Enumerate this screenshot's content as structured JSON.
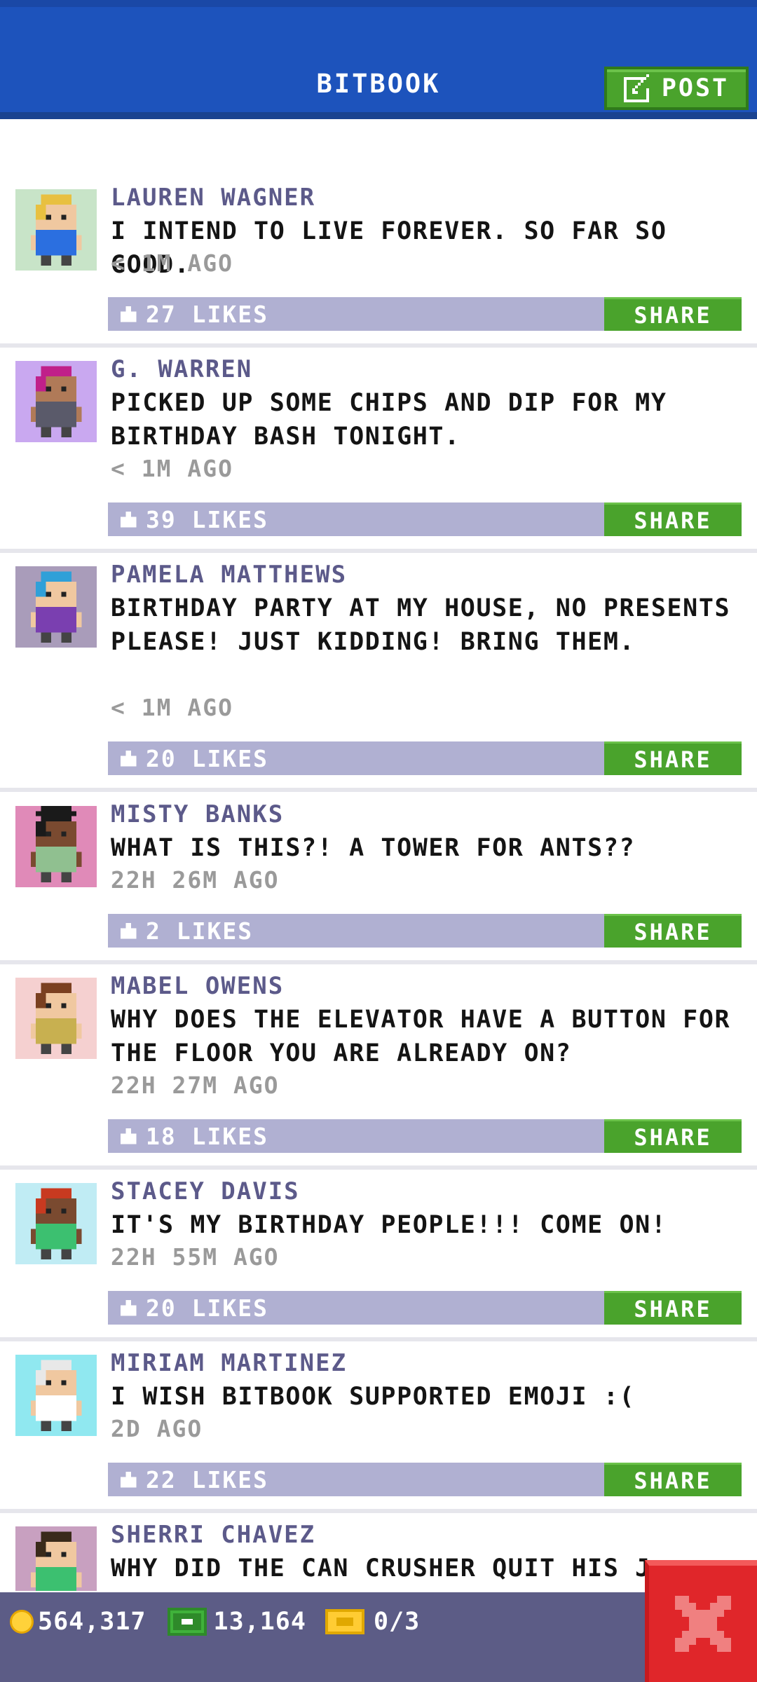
{
  "header": {
    "title": "BITBOOK",
    "post_label": "POST"
  },
  "posts": [
    {
      "name": "LAUREN WAGNER",
      "text": "I INTEND TO LIVE FOREVER. SO FAR SO GOOD.",
      "time": "< 1M AGO",
      "likes": "27 LIKES",
      "share": "SHARE",
      "avatar_bg": "#c8e4c8",
      "avatar_shirt": "#2b6fe0",
      "avatar_hair": "#e8c040"
    },
    {
      "name": "G. WARREN",
      "text": "PICKED UP SOME CHIPS AND DIP FOR MY BIRTHDAY BASH TONIGHT.",
      "time": "< 1M AGO",
      "likes": "39 LIKES",
      "share": "SHARE",
      "avatar_bg": "#c9a8f0",
      "avatar_shirt": "#5a5a6a",
      "avatar_hair": "#c0208a"
    },
    {
      "name": "PAMELA MATTHEWS",
      "text": "BIRTHDAY PARTY AT MY HOUSE, NO PRESENTS PLEASE! JUST KIDDING! BRING THEM.",
      "time": "< 1M AGO",
      "likes": "20 LIKES",
      "share": "SHARE",
      "avatar_bg": "#a99cba",
      "avatar_shirt": "#7a3fb0",
      "avatar_hair": "#30a0d8"
    },
    {
      "name": "MISTY BANKS",
      "text": "WHAT IS THIS?! A TOWER FOR ANTS??",
      "time": "22H 26M AGO",
      "likes": "2 LIKES",
      "share": "SHARE",
      "avatar_bg": "#e08ab8",
      "avatar_shirt": "#90c090",
      "avatar_hair": "#1a1a1a"
    },
    {
      "name": "MABEL OWENS",
      "text": "WHY DOES THE ELEVATOR HAVE A BUTTON FOR THE FLOOR YOU ARE ALREADY ON?",
      "time": "22H 27M AGO",
      "likes": "18 LIKES",
      "share": "SHARE",
      "avatar_bg": "#f5d0d0",
      "avatar_shirt": "#c8b050",
      "avatar_hair": "#7a4020"
    },
    {
      "name": "STACEY DAVIS",
      "text": "IT'S MY BIRTHDAY PEOPLE!!! COME ON!",
      "time": "22H 55M AGO",
      "likes": "20 LIKES",
      "share": "SHARE",
      "avatar_bg": "#c0ecf4",
      "avatar_shirt": "#3cc070",
      "avatar_hair": "#c83a20"
    },
    {
      "name": "MIRIAM MARTINEZ",
      "text": "I WISH BITBOOK SUPPORTED EMOJI :(",
      "time": "2D AGO",
      "likes": "22 LIKES",
      "share": "SHARE",
      "avatar_bg": "#90e8f0",
      "avatar_shirt": "#ffffff",
      "avatar_hair": "#e8e8e8"
    },
    {
      "name": "SHERRI CHAVEZ",
      "text": "WHY DID THE CAN CRUSHER QUIT HIS J",
      "time": "",
      "likes": "",
      "share": "",
      "avatar_bg": "#c8a0c0",
      "avatar_shirt": "#3cc070",
      "avatar_hair": "#3a2a1a"
    }
  ],
  "bottom": {
    "coins": "564,317",
    "bux": "13,164",
    "tickets": "0/3"
  },
  "colors": {
    "header": "#1d53bc",
    "share": "#4aa32c",
    "likes_bar": "#b0b0d2",
    "name": "#5c5a8a",
    "bottom_bar": "#5c5c86",
    "close": "#e0262a"
  },
  "icons": {
    "post": "edit-icon",
    "like": "thumbs-up-icon",
    "coins": "coin-icon",
    "bux": "bux-icon",
    "tickets": "ticket-icon",
    "close": "close-icon"
  }
}
